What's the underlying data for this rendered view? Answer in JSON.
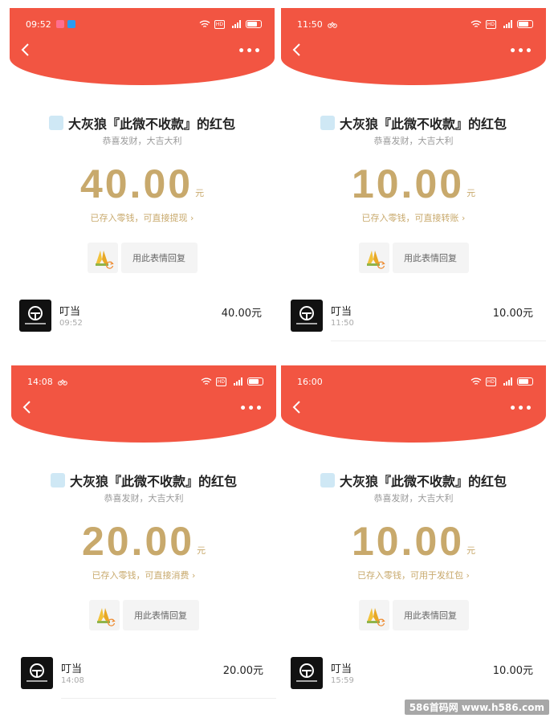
{
  "panels": [
    {
      "status_time": "09:52",
      "title": "大灰狼『此微不收款』的红包",
      "wish": "恭喜发财，大吉大利",
      "amount": "40.00",
      "unit": "元",
      "hint": "已存入零钱，可直接提现 ›",
      "reply_label": "用此表情回复",
      "record_name": "叮当",
      "record_time": "09:52",
      "record_amount": "40.00元"
    },
    {
      "status_time": "11:50",
      "title": "大灰狼『此微不收款』的红包",
      "wish": "恭喜发财，大吉大利",
      "amount": "10.00",
      "unit": "元",
      "hint": "已存入零钱，可直接转账 ›",
      "reply_label": "用此表情回复",
      "record_name": "叮当",
      "record_time": "11:50",
      "record_amount": "10.00元"
    },
    {
      "status_time": "14:08",
      "title": "大灰狼『此微不收款』的红包",
      "wish": "恭喜发财，大吉大利",
      "amount": "20.00",
      "unit": "元",
      "hint": "已存入零钱，可直接消费 ›",
      "reply_label": "用此表情回复",
      "record_name": "叮当",
      "record_time": "14:08",
      "record_amount": "20.00元"
    },
    {
      "status_time": "16:00",
      "title": "大灰狼『此微不收款』的红包",
      "wish": "恭喜发财，大吉大利",
      "amount": "10.00",
      "unit": "元",
      "hint": "已存入零钱，可用于发红包 ›",
      "reply_label": "用此表情回复",
      "record_name": "叮当",
      "record_time": "15:59",
      "record_amount": "10.00元"
    }
  ],
  "more_label": "•••",
  "watermark": "586首码网 www.h586.com",
  "colors": {
    "red_cap": "#f25542",
    "gold": "#c8a96c"
  },
  "icons": {
    "back": "chevron-left-icon",
    "more": "more-dots-icon",
    "wifi": "wifi-icon",
    "signal": "signal-icon",
    "battery": "battery-icon",
    "emoji": "praying-hands-emoji-icon",
    "refresh": "refresh-icon"
  }
}
